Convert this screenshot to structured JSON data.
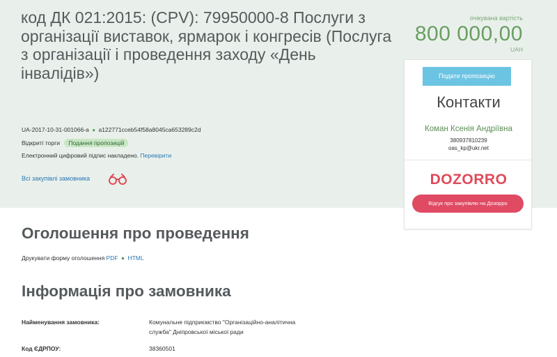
{
  "tender": {
    "title": "код ДК 021:2015: (CPV): 79950000-8 Послуги з організації виставок, ярмарок і конгресів (Послуга з організації і проведення заходу «День інвалідів»)",
    "id": "UA-2017-10-31-001066-a",
    "hash": "a122771cceb54f58a8045ca653289c2d",
    "procedure": "Відкриті торги",
    "status": "Подання пропозицій",
    "signature_text": "Електронний цифровий підпис накладено.",
    "verify_link": "Перевірити",
    "all_purchases_link": "Всі закупівлі замовника",
    "binoculars_icon": "binoculars-icon"
  },
  "price": {
    "label": "очікувана вартість",
    "value": "800 000,00",
    "currency": "UAH"
  },
  "sidebar": {
    "submit_button": "Подати пропозицію",
    "contacts_title": "Контакти",
    "contact_name": "Коман Ксенія Андріївна",
    "phone": "380937810239",
    "email": "oas_kp@ukr.net",
    "dozorro_logo": "DOZORRO",
    "dozorro_button": "Відгук про закупівлю на Дозорро"
  },
  "announcement": {
    "title": "Оголошення про проведення",
    "print_label": "Друкувати форму оголошення",
    "pdf": "PDF",
    "html": "HTML"
  },
  "customer_info": {
    "title": "Інформація про замовника",
    "name_label": "Найменування замовника:",
    "name_value": "Комунальне підприємство \"Організаційно-аналітична служба\" Дніпровської міської ради",
    "edrpou_label": "Код ЄДРПОУ:",
    "edrpou_value": "38360501"
  },
  "colors": {
    "hero_bg": "#e9f0eb",
    "price_green": "#6a9e62",
    "link_blue": "#2b78b4",
    "offer_button": "#6cc4e3",
    "dozorro_red": "#e04a63"
  }
}
